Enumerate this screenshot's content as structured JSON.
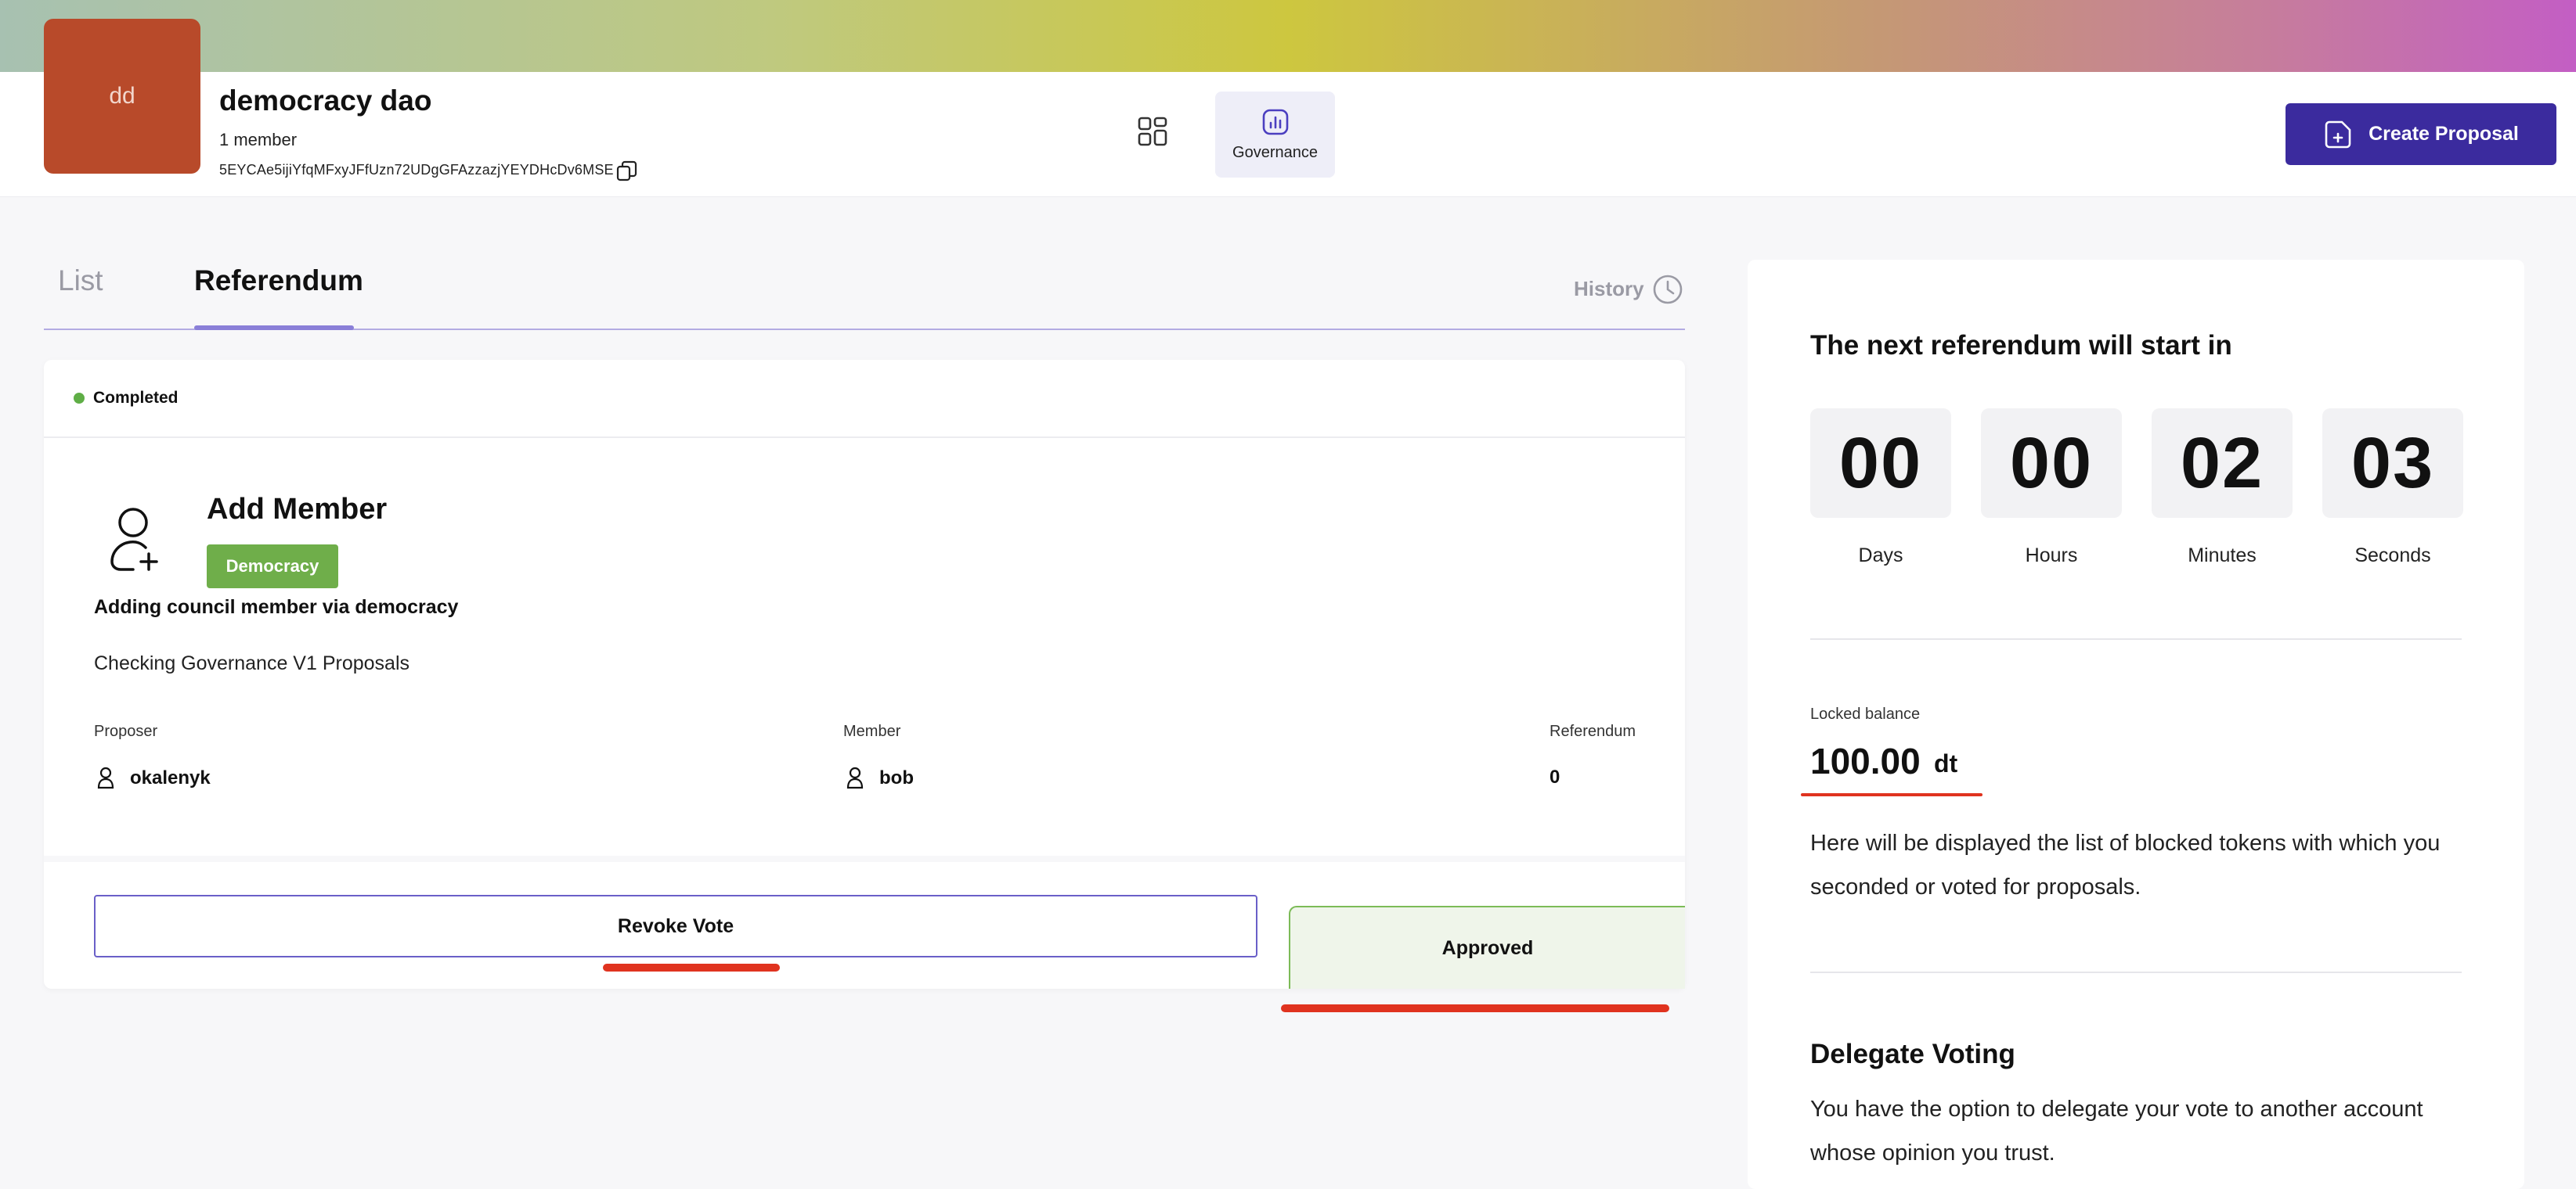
{
  "dao": {
    "avatar_initials": "dd",
    "name": "democracy dao",
    "members": "1 member",
    "address": "5EYCAe5ijiYfqMFxyJFfUzn72UDgGFAzzazjYEYDHcDv6MSE"
  },
  "nav": {
    "governance_label": "Governance",
    "create_proposal_label": "Create Proposal"
  },
  "tabs": {
    "list_label": "List",
    "referendum_label": "Referendum",
    "history_label": "History"
  },
  "proposal": {
    "status": "Completed",
    "title": "Add Member",
    "badge": "Democracy",
    "subtitle": "Adding council member via democracy",
    "description": "Checking Governance V1 Proposals",
    "proposer_label": "Proposer",
    "proposer_value": "okalenyk",
    "member_label": "Member",
    "member_value": "bob",
    "referendum_label": "Referendum",
    "referendum_value": "0",
    "revoke_label": "Revoke Vote",
    "approved_label": "Approved"
  },
  "sidebar": {
    "countdown_title": "The next referendum will start in",
    "countdown": [
      {
        "value": "00",
        "label": "Days"
      },
      {
        "value": "00",
        "label": "Hours"
      },
      {
        "value": "02",
        "label": "Minutes"
      },
      {
        "value": "03",
        "label": "Seconds"
      }
    ],
    "locked_label": "Locked balance",
    "locked_value": "100.00",
    "locked_unit": "dt",
    "locked_desc": "Here will be displayed the list of blocked tokens with which you seconded or voted for proposals.",
    "delegate_title": "Delegate Voting",
    "delegate_desc": "You have the option to delegate your vote to another account whose opinion you trust."
  },
  "colors": {
    "accent": "#3b2b9e",
    "badge_green": "#6fae4a",
    "status_green": "#5fae46",
    "annotation_red": "#e0331f",
    "avatar": "#b84a2a"
  },
  "icons": [
    "copy-icon",
    "grid-icon",
    "bar-chart-icon",
    "document-plus-icon",
    "clock-icon",
    "user-add-icon",
    "user-icon"
  ]
}
